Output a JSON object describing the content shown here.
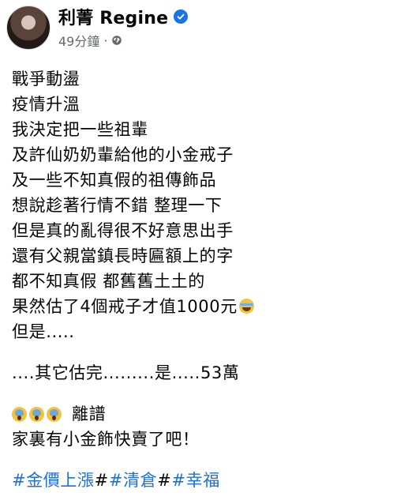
{
  "author": {
    "name": "利菁 Regine",
    "verified_icon": "verified-badge-icon",
    "timestamp": "49分鐘",
    "separator": "·",
    "privacy_icon": "globe-icon"
  },
  "post": {
    "lines": [
      "戰爭動盪",
      "疫情升溫",
      "我決定把一些祖輩",
      "及許仙奶奶輩給他的小金戒子",
      "及一些不知真假的祖傳飾品",
      "想說趁著行情不錯 整理一下",
      "但是真的亂得很不好意思出手",
      "還有父親當鎮長時匾額上的字",
      "都不知真假 都舊舊土土的",
      "果然估了4個戒子才值1000元",
      "但是....."
    ],
    "line_after_gap": "....其它估完.........是.....53萬",
    "emoji_text": "離譜",
    "closing_line": "家裏有小金飾快賣了吧！",
    "hashtags": [
      "#金價上漲",
      "#清倉",
      "#幸福"
    ],
    "hashtag_separators": [
      "#",
      "#"
    ]
  },
  "colors": {
    "accent": "#216fdb",
    "verified": "#1b74e4",
    "secondary_text": "#65676b"
  }
}
